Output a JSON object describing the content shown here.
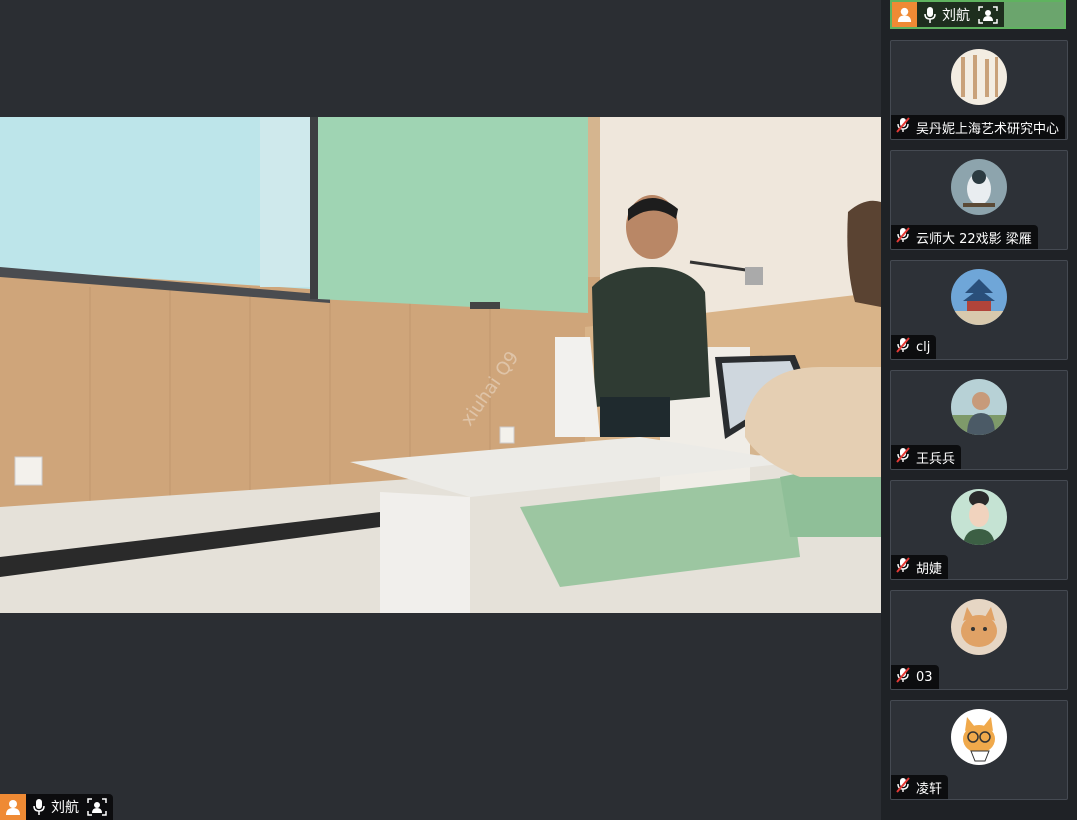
{
  "main_video": {
    "speaker_name": "刘航",
    "watermark": "xiuhai Q9 xiuhai..."
  },
  "self_view": {
    "name": "刘航"
  },
  "participants": [
    {
      "name": "吴丹妮上海艺术研究中心",
      "muted": true,
      "avatar": "calligraphy-avatar"
    },
    {
      "name": "云师大 22戏影 梁雁",
      "muted": true,
      "avatar": "bird-avatar"
    },
    {
      "name": "clj",
      "muted": true,
      "avatar": "temple-avatar"
    },
    {
      "name": "王兵兵",
      "muted": true,
      "avatar": "photo-avatar"
    },
    {
      "name": "胡婕",
      "muted": true,
      "avatar": "illustration-avatar"
    },
    {
      "name": "03",
      "muted": true,
      "avatar": "cat-avatar"
    },
    {
      "name": "凌轩",
      "muted": true,
      "avatar": "cartoon-cat-avatar"
    }
  ],
  "colors": {
    "host_badge": "#ef8a34",
    "active_speaker_border": "#5fb35f",
    "background": "#2b2e33"
  }
}
